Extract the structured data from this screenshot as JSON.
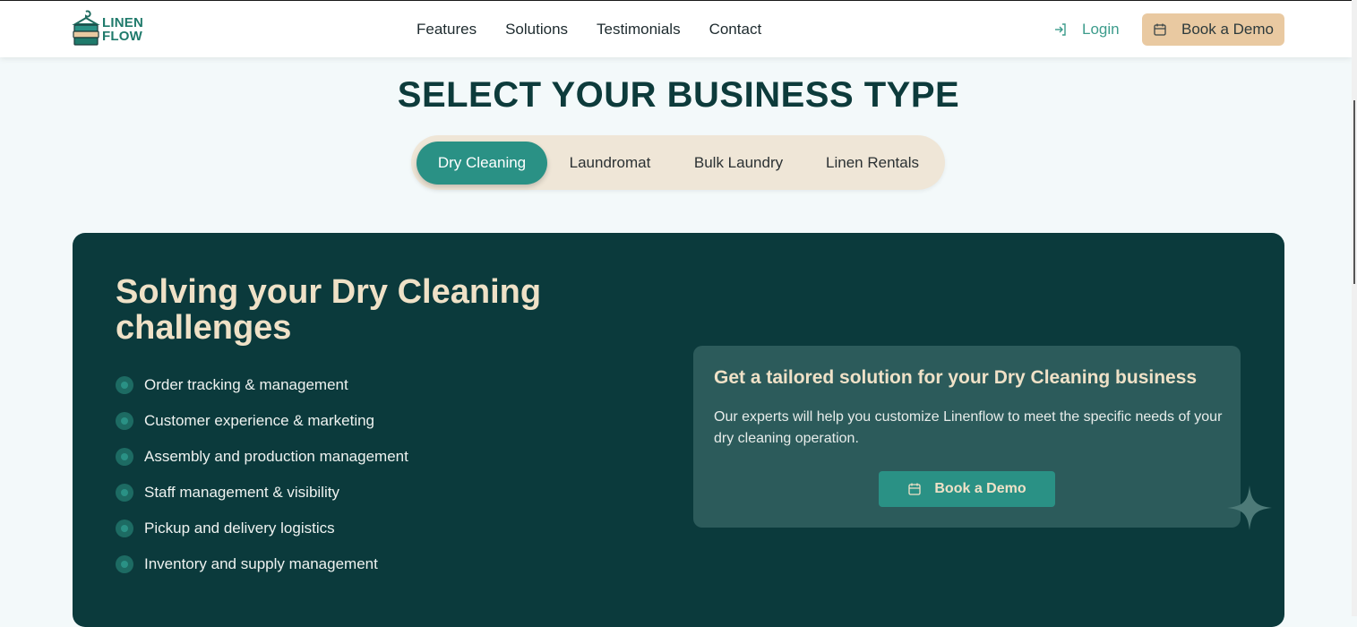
{
  "header": {
    "logo_line1": "LINEN",
    "logo_line2": "FLOW",
    "nav": [
      "Features",
      "Solutions",
      "Testimonials",
      "Contact"
    ],
    "login_label": "Login",
    "demo_label": "Book a Demo"
  },
  "section": {
    "title": "SELECT YOUR BUSINESS TYPE",
    "tabs": [
      {
        "label": "Dry Cleaning",
        "active": true
      },
      {
        "label": "Laundromat",
        "active": false
      },
      {
        "label": "Bulk Laundry",
        "active": false
      },
      {
        "label": "Linen Rentals",
        "active": false
      }
    ]
  },
  "panel": {
    "title": "Solving your Dry Cleaning challenges",
    "features": [
      "Order tracking & management",
      "Customer experience & marketing",
      "Assembly and production management",
      "Staff management & visibility",
      "Pickup and delivery logistics",
      "Inventory and supply management"
    ],
    "card": {
      "title": "Get a tailored solution for your Dry Cleaning business",
      "text": "Our experts will help you customize Linenflow to meet the specific needs of your dry cleaning operation.",
      "button": "Book a Demo"
    }
  },
  "colors": {
    "accent": "#2a9185",
    "dark_panel": "#0b3a3c",
    "demo_button": "#e9c9a1",
    "title_cream": "#efe1c7"
  },
  "icons": {
    "logo": "hanger-stack-icon",
    "login": "login-arrow-icon",
    "demo": "calendar-icon",
    "bullet": "dot-icon",
    "decor": "sparkle-icon"
  }
}
